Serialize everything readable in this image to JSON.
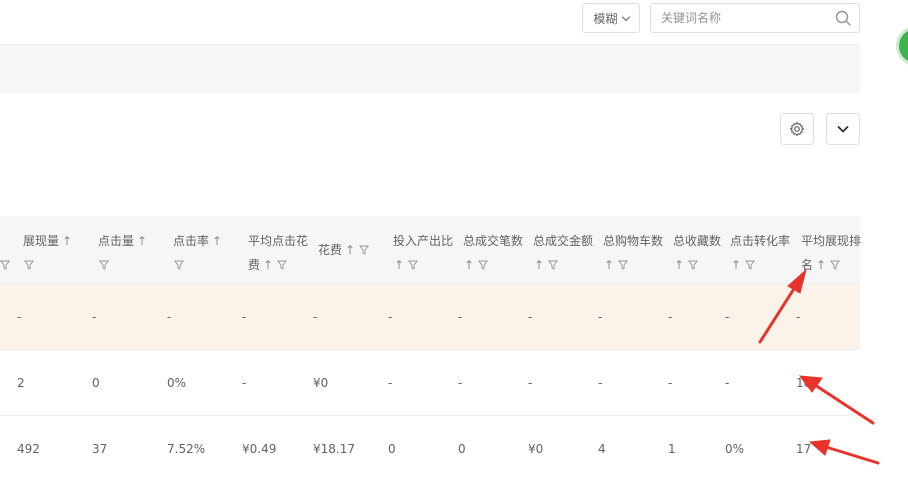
{
  "search": {
    "mode_label": "模糊",
    "placeholder": "关键词名称",
    "value": ""
  },
  "table": {
    "columns": [
      {
        "line1": "",
        "line2": ""
      },
      {
        "line1": "展现量",
        "line2": ""
      },
      {
        "line1": "点击量",
        "line2": ""
      },
      {
        "line1": "点击率",
        "line2": ""
      },
      {
        "line1": "平均点击花",
        "line2": "费"
      },
      {
        "line1": "花费",
        "line2": ""
      },
      {
        "line1": "投入产出比",
        "line2": ""
      },
      {
        "line1": "总成交笔数",
        "line2": ""
      },
      {
        "line1": "总成交金额",
        "line2": ""
      },
      {
        "line1": "总购物车数",
        "line2": ""
      },
      {
        "line1": "总收藏数",
        "line2": ""
      },
      {
        "line1": "点击转化率",
        "line2": ""
      },
      {
        "line1": "平均展现排",
        "line2": "名"
      }
    ],
    "sort_glyph": "↑",
    "rows": [
      [
        "",
        "-",
        "-",
        "-",
        "-",
        "-",
        "-",
        "-",
        "-",
        "-",
        "-",
        "-",
        "-"
      ],
      [
        "",
        "2",
        "0",
        "0%",
        "-",
        "¥0",
        "-",
        "-",
        "-",
        "-",
        "-",
        "-",
        "16"
      ],
      [
        "",
        "492",
        "37",
        "7.52%",
        "¥0.49",
        "¥18.17",
        "0",
        "0",
        "¥0",
        "4",
        "1",
        "0%",
        "17"
      ]
    ]
  },
  "colors": {
    "header_bg": "#f5f6f8",
    "summary_row_bg": "#fbf2ea",
    "annotation_red": "#e8332a",
    "badge_green": "#3fb34f"
  }
}
